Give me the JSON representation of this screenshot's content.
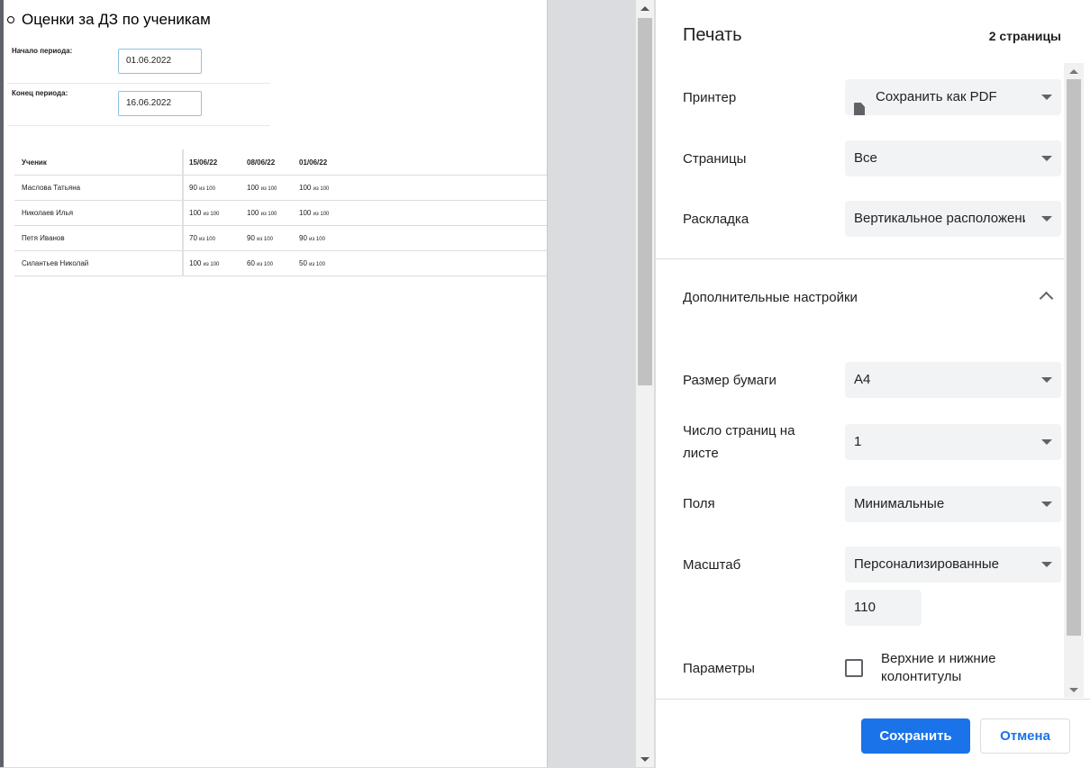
{
  "preview": {
    "title": "Оценки за ДЗ по ученикам",
    "period_start_label": "Начало периода:",
    "period_start_value": "01.06.2022",
    "period_end_label": "Конец периода:",
    "period_end_value": "16.06.2022",
    "table": {
      "headers": [
        "Ученик",
        "15/06/22",
        "08/06/22",
        "01/06/22"
      ],
      "rows": [
        {
          "name": "Маслова Татьяна",
          "grades": [
            {
              "score": "90",
              "of": "из 100"
            },
            {
              "score": "100",
              "of": "из 100"
            },
            {
              "score": "100",
              "of": "из 100"
            }
          ]
        },
        {
          "name": "Николаев Илья",
          "grades": [
            {
              "score": "100",
              "of": "из 100"
            },
            {
              "score": "100",
              "of": "из 100"
            },
            {
              "score": "100",
              "of": "из 100"
            }
          ]
        },
        {
          "name": "Петя Иванов",
          "grades": [
            {
              "score": "70",
              "of": "из 100"
            },
            {
              "score": "90",
              "of": "из 100"
            },
            {
              "score": "90",
              "of": "из 100"
            }
          ]
        },
        {
          "name": "Силантьев Николай",
          "grades": [
            {
              "score": "100",
              "of": "из 100"
            },
            {
              "score": "60",
              "of": "из 100"
            },
            {
              "score": "50",
              "of": "из 100"
            }
          ]
        }
      ]
    }
  },
  "panel": {
    "title": "Печать",
    "pages_count": "2 страницы",
    "printer": {
      "label": "Принтер",
      "value": "Сохранить как PDF",
      "icon": "pdf-doc-icon"
    },
    "pages": {
      "label": "Страницы",
      "value": "Все"
    },
    "layout": {
      "label": "Раскладка",
      "value": "Вертикальное расположение"
    },
    "advanced": {
      "label": "Дополнительные настройки"
    },
    "paper_size": {
      "label": "Размер бумаги",
      "value": "A4"
    },
    "pages_per_sheet": {
      "label_line1": "Число страниц на",
      "label_line2": "листе",
      "value": "1"
    },
    "margins": {
      "label": "Поля",
      "value": "Минимальные"
    },
    "scale": {
      "label": "Масштаб",
      "value": "Персонализированные",
      "custom_value": "110"
    },
    "options": {
      "label": "Параметры",
      "headers_footers": "Верхние и нижние колонтитулы",
      "checked": false
    },
    "save_button": "Сохранить",
    "cancel_button": "Отмена"
  },
  "colors": {
    "accent": "#1a73e8",
    "field_bg": "#f1f3f4"
  }
}
